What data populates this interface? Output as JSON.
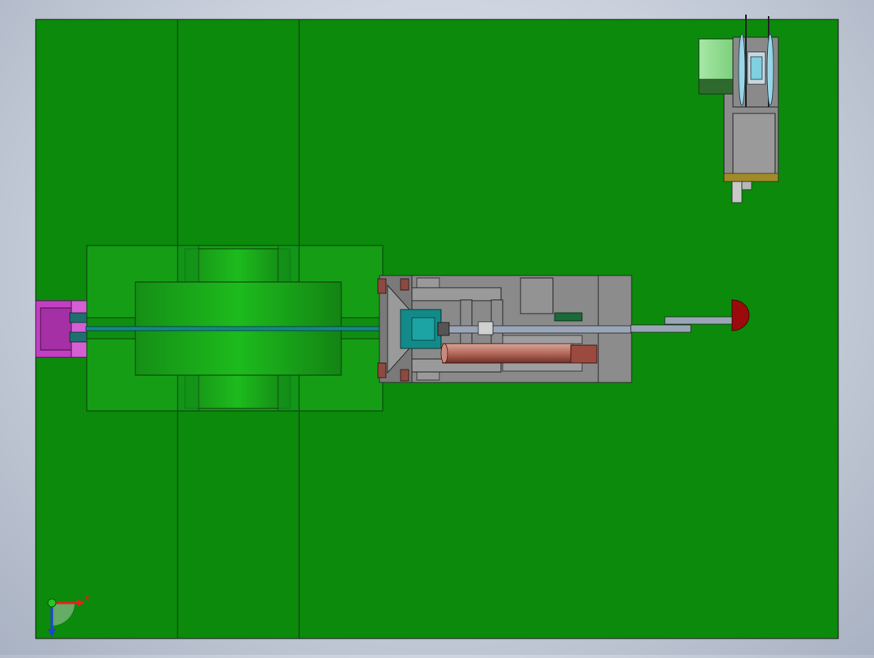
{
  "view": {
    "background_gradient": [
      "#e9edf4",
      "#a9b2c2"
    ],
    "plate_color": "#0b8a0b",
    "module_green": "#17a617",
    "steel_gray": "#8c8c8c",
    "magenta_part": "#c23fc2",
    "teal_part": "#138a8a",
    "copper_cylinder": "#b86a5e",
    "knob_red": "#9b0b0b"
  },
  "triad": {
    "x_label": "X",
    "x_color": "#e52020",
    "y_color": "#22c822",
    "z_color": "#2040d8"
  }
}
